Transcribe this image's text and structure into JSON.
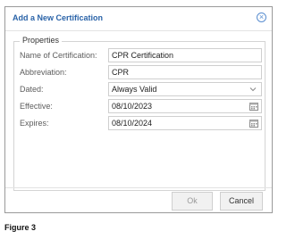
{
  "dialog": {
    "title": "Add a New Certification",
    "close_icon": "close-circle-icon",
    "accent_color": "#2a63a8"
  },
  "properties": {
    "legend": "Properties",
    "fields": [
      {
        "label": "Name of Certification:",
        "value": "CPR Certification",
        "type": "text"
      },
      {
        "label": "Abbreviation:",
        "value": "CPR",
        "type": "text"
      },
      {
        "label": "Dated:",
        "value": "Always Valid",
        "type": "select",
        "icon": "chevron-down-icon"
      },
      {
        "label": "Effective:",
        "value": "08/10/2023",
        "type": "date",
        "icon": "calendar-icon"
      },
      {
        "label": "Expires:",
        "value": "08/10/2024",
        "type": "date",
        "icon": "calendar-icon"
      }
    ]
  },
  "footer": {
    "ok_label": "Ok",
    "cancel_label": "Cancel"
  },
  "caption": "Figure 3"
}
